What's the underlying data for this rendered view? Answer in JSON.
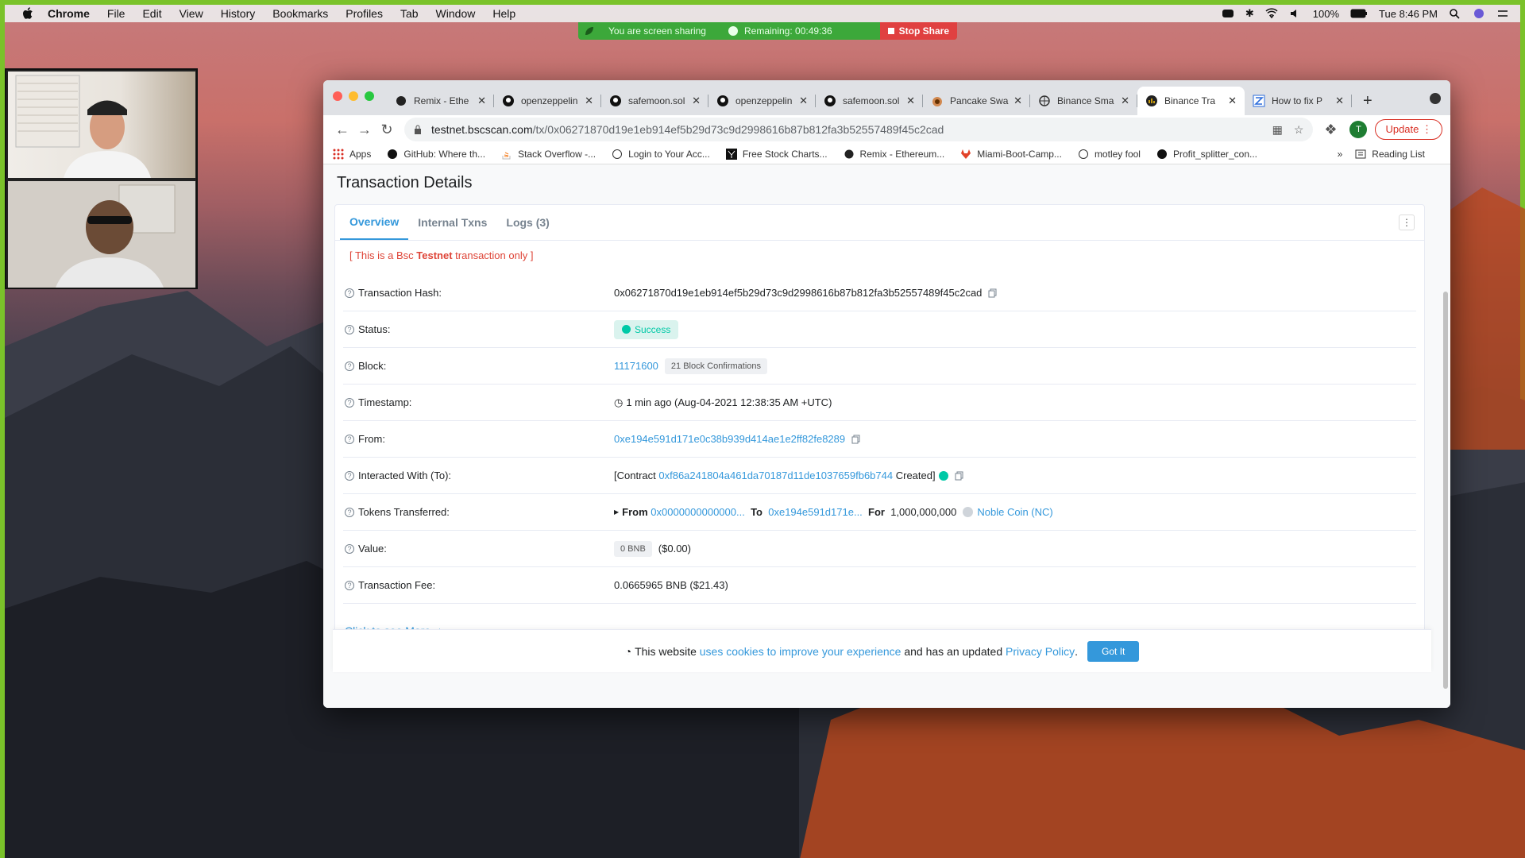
{
  "menubar": {
    "items": [
      "Chrome",
      "File",
      "Edit",
      "View",
      "History",
      "Bookmarks",
      "Profiles",
      "Tab",
      "Window",
      "Help"
    ],
    "battery": "100%",
    "clock": "Tue 8:46 PM"
  },
  "share_banner": {
    "sharing_text": "You are screen sharing",
    "remaining": "Remaining: 00:49:36",
    "stop": "Stop Share"
  },
  "browser": {
    "tabs": [
      {
        "label": "Remix - Ethe",
        "icon": "remix-icon"
      },
      {
        "label": "openzeppelin",
        "icon": "github-icon"
      },
      {
        "label": "safemoon.sol",
        "icon": "github-icon"
      },
      {
        "label": "openzeppelin",
        "icon": "github-icon"
      },
      {
        "label": "safemoon.sol",
        "icon": "github-icon"
      },
      {
        "label": "Pancake Swap",
        "icon": "pancake-icon"
      },
      {
        "label": "Binance Sma",
        "icon": "globe-icon"
      },
      {
        "label": "Binance Tra",
        "icon": "bscscan-icon"
      },
      {
        "label": "How to fix P",
        "icon": "z-icon"
      }
    ],
    "url_host": "testnet.bscscan.com",
    "url_path": "/tx/0x06271870d19e1eb914ef5b29d73c9d2998616b87b812fa3b52557489f45c2cad",
    "avatar": "T",
    "update": "Update",
    "bookmarks": [
      "Apps",
      "GitHub: Where th...",
      "Stack Overflow -...",
      "Login to Your Acc...",
      "Free Stock Charts...",
      "Remix - Ethereum...",
      "Miami-Boot-Camp...",
      "motley fool",
      "Profit_splitter_con..."
    ],
    "reading_list": "Reading List"
  },
  "page": {
    "title": "Transaction Details",
    "tabs": [
      "Overview",
      "Internal Txns",
      "Logs (3)"
    ],
    "testnet_prefix": "[ This is a Bsc ",
    "testnet_bold": "Testnet",
    "testnet_suffix": " transaction only ]",
    "rows": {
      "hash_label": "Transaction Hash:",
      "hash_value": "0x06271870d19e1eb914ef5b29d73c9d2998616b87b812fa3b52557489f45c2cad",
      "status_label": "Status:",
      "status_value": "Success",
      "block_label": "Block:",
      "block_value": "11171600",
      "block_confirm": "21 Block Confirmations",
      "timestamp_label": "Timestamp:",
      "timestamp_value": "1 min ago (Aug-04-2021 12:38:35 AM +UTC)",
      "from_label": "From:",
      "from_value": "0xe194e591d171e0c38b939d414ae1e2ff82fe8289",
      "to_label": "Interacted With (To):",
      "to_prefix": "[Contract",
      "to_value": "0xf86a241804a461da70187d11de1037659fb6b744",
      "to_suffix": "Created]",
      "tokens_label": "Tokens Transferred:",
      "tokens_from_kw": "From",
      "tokens_from": "0x0000000000000...",
      "tokens_to_kw": "To",
      "tokens_to": "0xe194e591d171e...",
      "tokens_for_kw": "For",
      "tokens_amount": "1,000,000,000",
      "tokens_name": "Noble Coin (NC)",
      "value_label": "Value:",
      "value_bnb": "0 BNB",
      "value_usd": "($0.00)",
      "fee_label": "Transaction Fee:",
      "fee_value": "0.0665965 BNB ($21.43)"
    },
    "see_more": "Click to see More",
    "cookie": {
      "pre": "This website",
      "link1": "uses cookies to improve your experience",
      "mid": "and has an updated",
      "link2": "Privacy Policy",
      "post": ".",
      "button": "Got It"
    }
  },
  "colors": {
    "accent": "#3498db",
    "success": "#00c9a7",
    "danger": "#de4437",
    "share_green": "#3ca83a",
    "frame_green": "#7ac22a"
  }
}
